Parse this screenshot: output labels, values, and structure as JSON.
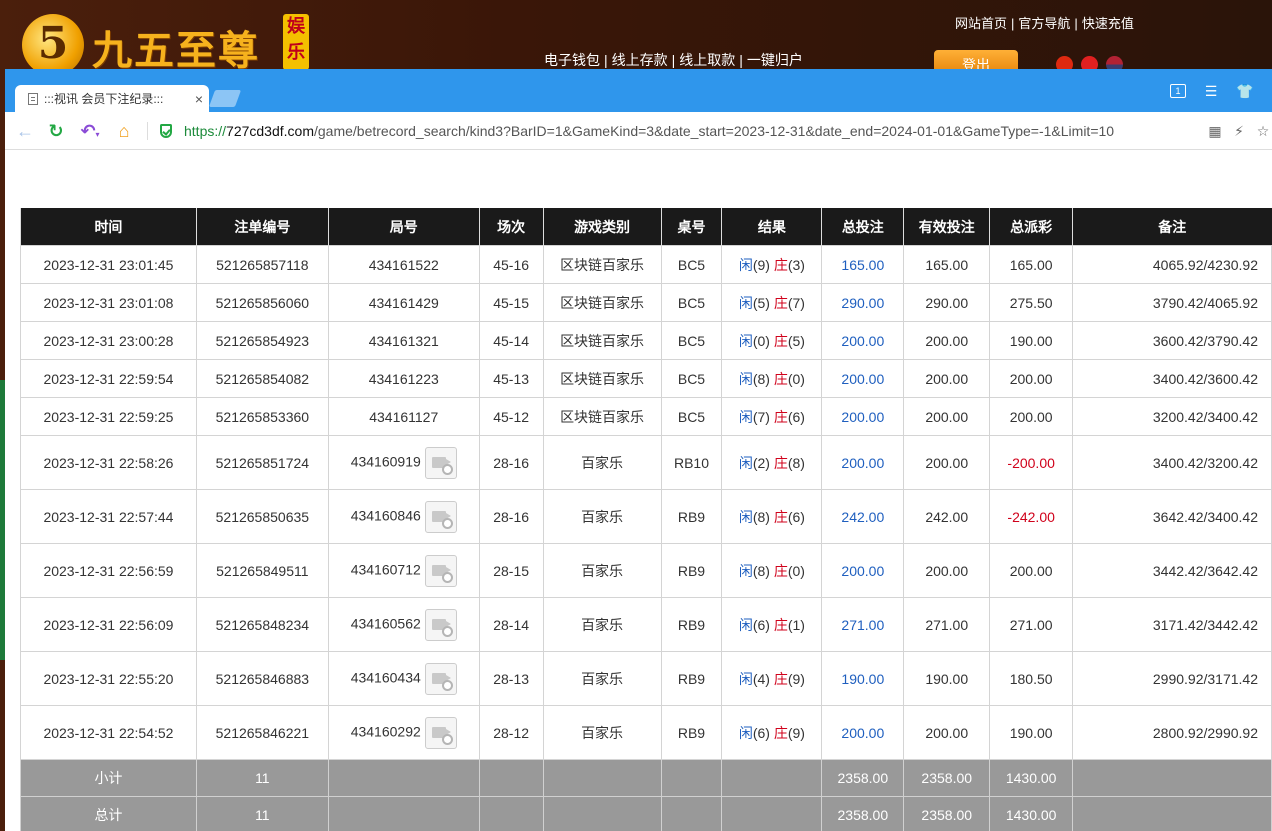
{
  "site": {
    "logo_mark": "5",
    "logo_text": "九五至尊",
    "logo_badge": "娱乐",
    "top_nav": [
      "网站首页",
      "官方导航",
      "快速充值"
    ],
    "wallet_nav": [
      "电子钱包",
      "线上存款",
      "线上取款",
      "一键归户"
    ],
    "logout_label": "登出",
    "separator": "|"
  },
  "browser": {
    "tab_title": ":::视讯 会员下注纪录:::",
    "tab_close": "×",
    "url_scheme": "https://",
    "url_host": "727cd3df.com",
    "url_path": "/game/betrecord_search/kind3?BarID=1&GameKind=3&date_start=2023-12-31&date_end=2024-01-01&GameType=-1&Limit=10",
    "window_ctrl_box": "1"
  },
  "table": {
    "headers": [
      "时间",
      "注单编号",
      "局号",
      "场次",
      "游戏类别",
      "桌号",
      "结果",
      "总投注",
      "有效投注",
      "总派彩",
      "备注"
    ],
    "result_player": "闲",
    "result_banker": "庄",
    "rows": [
      {
        "time": "2023-12-31 23:01:45",
        "bet_no": "521265857118",
        "round": "434161522",
        "session": "45-16",
        "game": "区块链百家乐",
        "table": "BC5",
        "p": "(9)",
        "b": "(3)",
        "total": "165.00",
        "valid": "165.00",
        "payout": "165.00",
        "remark": "4065.92/4230.92",
        "video": false
      },
      {
        "time": "2023-12-31 23:01:08",
        "bet_no": "521265856060",
        "round": "434161429",
        "session": "45-15",
        "game": "区块链百家乐",
        "table": "BC5",
        "p": "(5)",
        "b": "(7)",
        "total": "290.00",
        "valid": "290.00",
        "payout": "275.50",
        "remark": "3790.42/4065.92",
        "video": false
      },
      {
        "time": "2023-12-31 23:00:28",
        "bet_no": "521265854923",
        "round": "434161321",
        "session": "45-14",
        "game": "区块链百家乐",
        "table": "BC5",
        "p": "(0)",
        "b": "(5)",
        "total": "200.00",
        "valid": "200.00",
        "payout": "190.00",
        "remark": "3600.42/3790.42",
        "video": false
      },
      {
        "time": "2023-12-31 22:59:54",
        "bet_no": "521265854082",
        "round": "434161223",
        "session": "45-13",
        "game": "区块链百家乐",
        "table": "BC5",
        "p": "(8)",
        "b": "(0)",
        "total": "200.00",
        "valid": "200.00",
        "payout": "200.00",
        "remark": "3400.42/3600.42",
        "video": false
      },
      {
        "time": "2023-12-31 22:59:25",
        "bet_no": "521265853360",
        "round": "434161127",
        "session": "45-12",
        "game": "区块链百家乐",
        "table": "BC5",
        "p": "(7)",
        "b": "(6)",
        "total": "200.00",
        "valid": "200.00",
        "payout": "200.00",
        "remark": "3200.42/3400.42",
        "video": false
      },
      {
        "time": "2023-12-31 22:58:26",
        "bet_no": "521265851724",
        "round": "434160919",
        "session": "28-16",
        "game": "百家乐",
        "table": "RB10",
        "p": "(2)",
        "b": "(8)",
        "total": "200.00",
        "valid": "200.00",
        "payout": "-200.00",
        "remark": "3400.42/3200.42",
        "video": true
      },
      {
        "time": "2023-12-31 22:57:44",
        "bet_no": "521265850635",
        "round": "434160846",
        "session": "28-16",
        "game": "百家乐",
        "table": "RB9",
        "p": "(8)",
        "b": "(6)",
        "total": "242.00",
        "valid": "242.00",
        "payout": "-242.00",
        "remark": "3642.42/3400.42",
        "video": true
      },
      {
        "time": "2023-12-31 22:56:59",
        "bet_no": "521265849511",
        "round": "434160712",
        "session": "28-15",
        "game": "百家乐",
        "table": "RB9",
        "p": "(8)",
        "b": "(0)",
        "total": "200.00",
        "valid": "200.00",
        "payout": "200.00",
        "remark": "3442.42/3642.42",
        "video": true
      },
      {
        "time": "2023-12-31 22:56:09",
        "bet_no": "521265848234",
        "round": "434160562",
        "session": "28-14",
        "game": "百家乐",
        "table": "RB9",
        "p": "(6)",
        "b": "(1)",
        "total": "271.00",
        "valid": "271.00",
        "payout": "271.00",
        "remark": "3171.42/3442.42",
        "video": true
      },
      {
        "time": "2023-12-31 22:55:20",
        "bet_no": "521265846883",
        "round": "434160434",
        "session": "28-13",
        "game": "百家乐",
        "table": "RB9",
        "p": "(4)",
        "b": "(9)",
        "total": "190.00",
        "valid": "190.00",
        "payout": "180.50",
        "remark": "2990.92/3171.42",
        "video": true
      },
      {
        "time": "2023-12-31 22:54:52",
        "bet_no": "521265846221",
        "round": "434160292",
        "session": "28-12",
        "game": "百家乐",
        "table": "RB9",
        "p": "(6)",
        "b": "(9)",
        "total": "200.00",
        "valid": "200.00",
        "payout": "190.00",
        "remark": "2800.92/2990.92",
        "video": true
      }
    ],
    "subtotal": {
      "label": "小计",
      "count": "11",
      "total": "2358.00",
      "valid": "2358.00",
      "payout": "1430.00"
    },
    "grandtotal": {
      "label": "总计",
      "count": "11",
      "total": "2358.00",
      "valid": "2358.00",
      "payout": "1430.00"
    }
  },
  "colors": {
    "tabstrip": "#2f96ec",
    "header_row": "#1a1a1a",
    "summary_row": "#999999",
    "amount_blue": "#1f5fbf",
    "negative_red": "#d0021b"
  }
}
